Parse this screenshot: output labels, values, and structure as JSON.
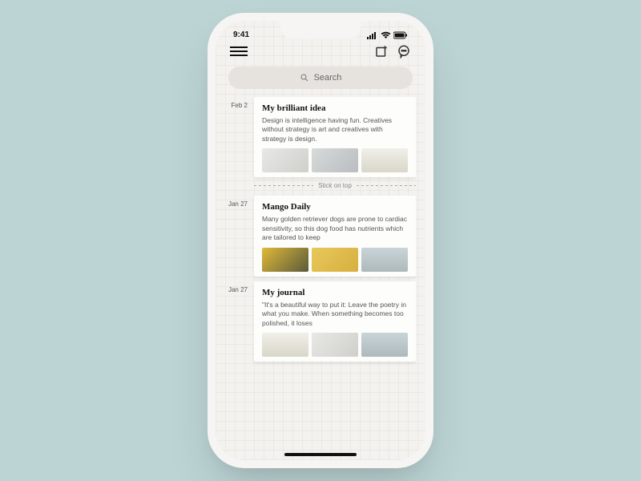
{
  "statusbar": {
    "time": "9:41"
  },
  "search": {
    "placeholder": "Search"
  },
  "divider_label": "Stick on top",
  "entries": [
    {
      "date": "Feb 2",
      "title": "My brilliant idea",
      "body": "Design is intelligence having fun. Creatives without strategy is art and creatives with strategy is design."
    },
    {
      "date": "Jan 27",
      "title": "Mango Daily",
      "body": "Many golden retriever dogs are prone to cardiac sensitivity, so this dog food has nutrients which are tailored to keep"
    },
    {
      "date": "Jan 27",
      "title": "My journal",
      "body": "\"It's a beautiful way to put it: Leave the poetry in what you make. When something becomes too polished, it loses"
    }
  ]
}
